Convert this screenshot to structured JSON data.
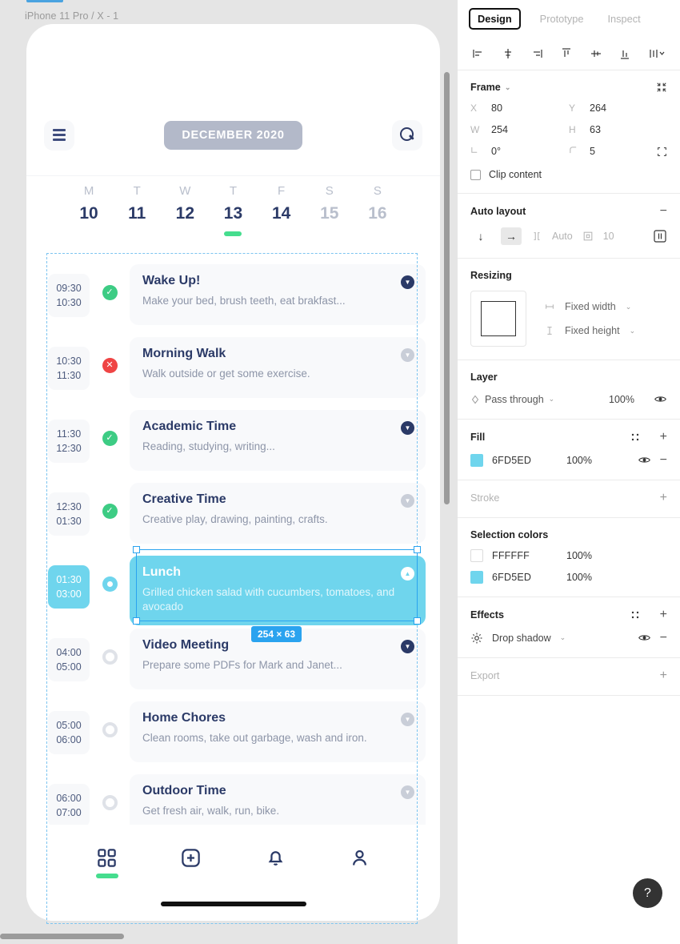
{
  "canvas": {
    "frame_label": "iPhone 11 Pro / X - 1",
    "selection": {
      "dimension_label": "254 × 63"
    }
  },
  "mobile": {
    "header": {
      "menu_icon": "hamburger-icon",
      "month_label": "DECEMBER 2020",
      "search_icon": "search-icon"
    },
    "week": [
      {
        "dow": "M",
        "num": "10",
        "active": false,
        "muted": false
      },
      {
        "dow": "T",
        "num": "11",
        "active": false,
        "muted": false
      },
      {
        "dow": "W",
        "num": "12",
        "active": false,
        "muted": false
      },
      {
        "dow": "T",
        "num": "13",
        "active": true,
        "muted": false
      },
      {
        "dow": "F",
        "num": "14",
        "active": false,
        "muted": false
      },
      {
        "dow": "S",
        "num": "15",
        "active": false,
        "muted": true
      },
      {
        "dow": "S",
        "num": "16",
        "active": false,
        "muted": true
      }
    ],
    "tasks": [
      {
        "start": "09:30",
        "end": "10:30",
        "status": "done",
        "title": "Wake Up!",
        "desc": "Make your bed, brush teeth, eat brakfast...",
        "chevron": "dark",
        "selected": false
      },
      {
        "start": "10:30",
        "end": "11:30",
        "status": "fail",
        "title": "Morning Walk",
        "desc": "Walk outside or get some exercise.",
        "chevron": "grey",
        "selected": false
      },
      {
        "start": "11:30",
        "end": "12:30",
        "status": "done",
        "title": "Academic Time",
        "desc": "Reading, studying, writing...",
        "chevron": "dark",
        "selected": false
      },
      {
        "start": "12:30",
        "end": "01:30",
        "status": "done",
        "title": "Creative Time",
        "desc": "Creative play, drawing, painting, crafts.",
        "chevron": "grey",
        "selected": false
      },
      {
        "start": "01:30",
        "end": "03:00",
        "status": "current",
        "title": "Lunch",
        "desc": "Grilled chicken salad with cucumbers, tomatoes, and avocado",
        "chevron": "light",
        "selected": true
      },
      {
        "start": "04:00",
        "end": "05:00",
        "status": "pending",
        "title": "Video Meeting",
        "desc": "Prepare some PDFs for Mark and Janet...",
        "chevron": "dark",
        "selected": false
      },
      {
        "start": "05:00",
        "end": "06:00",
        "status": "pending",
        "title": "Home Chores",
        "desc": "Clean rooms, take out garbage, wash and iron.",
        "chevron": "grey",
        "selected": false
      },
      {
        "start": "06:00",
        "end": "07:00",
        "status": "pending",
        "title": "Outdoor Time",
        "desc": "Get fresh air, walk, run, bike.",
        "chevron": "grey",
        "selected": false
      }
    ],
    "bottom_nav": [
      {
        "icon": "grid-icon",
        "active": true
      },
      {
        "icon": "plus-box-icon",
        "active": false
      },
      {
        "icon": "bell-icon",
        "active": false
      },
      {
        "icon": "person-icon",
        "active": false
      }
    ]
  },
  "panel": {
    "tabs": [
      {
        "label": "Design",
        "active": true
      },
      {
        "label": "Prototype",
        "active": false
      },
      {
        "label": "Inspect",
        "active": false
      }
    ],
    "align_icons": [
      "align-left-icon",
      "align-horizontal-center-icon",
      "align-right-icon",
      "align-top-icon",
      "align-vertical-center-icon",
      "align-bottom-icon",
      "distribute-menu-icon"
    ],
    "frame": {
      "title": "Frame",
      "collapse_icon": "collapse-icon",
      "x_label": "X",
      "x_value": "80",
      "y_label": "Y",
      "y_value": "264",
      "w_label": "W",
      "w_value": "254",
      "h_label": "H",
      "h_value": "63",
      "rotation_label": "rotation-icon",
      "rotation_value": "0°",
      "corner_label": "corner-radius-icon",
      "corner_value": "5",
      "independent_corners_icon": "independent-corners-icon",
      "clip_content_label": "Clip content",
      "clip_content_checked": false
    },
    "auto_layout": {
      "title": "Auto layout",
      "remove_icon": "minus-icon",
      "direction_vertical_icon": "arrow-down-icon",
      "direction_horizontal_icon": "arrow-right-icon",
      "spacing_icon": "spacing-icon",
      "spacing_value": "Auto",
      "padding_icon": "padding-icon",
      "padding_value": "10",
      "align_icon": "align-grid-icon"
    },
    "resizing": {
      "title": "Resizing",
      "preview_icon": "resize-preview-icon",
      "width_icon": "horizontal-resize-icon",
      "width_label": "Fixed width",
      "height_icon": "vertical-resize-icon",
      "height_label": "Fixed height"
    },
    "layer": {
      "title": "Layer",
      "blend_icon": "blend-mode-icon",
      "blend_mode": "Pass through",
      "opacity": "100%",
      "visibility_icon": "eye-icon"
    },
    "fill": {
      "title": "Fill",
      "styles_icon": "styles-icon",
      "add_icon": "plus-icon",
      "items": [
        {
          "color": "#6FD5ED",
          "hex": "6FD5ED",
          "opacity": "100%",
          "visibility_icon": "eye-icon",
          "remove_icon": "minus-icon"
        }
      ]
    },
    "stroke": {
      "title": "Stroke",
      "add_icon": "plus-icon"
    },
    "selection_colors": {
      "title": "Selection colors",
      "items": [
        {
          "color": "#FFFFFF",
          "hex": "FFFFFF",
          "opacity": "100%"
        },
        {
          "color": "#6FD5ED",
          "hex": "6FD5ED",
          "opacity": "100%"
        }
      ]
    },
    "effects": {
      "title": "Effects",
      "styles_icon": "styles-icon",
      "add_icon": "plus-icon",
      "items": [
        {
          "icon": "drop-shadow-icon",
          "label": "Drop shadow",
          "visibility_icon": "eye-icon",
          "remove_icon": "minus-icon"
        }
      ]
    },
    "export": {
      "title": "Export",
      "add_icon": "plus-icon"
    },
    "help_label": "?"
  }
}
